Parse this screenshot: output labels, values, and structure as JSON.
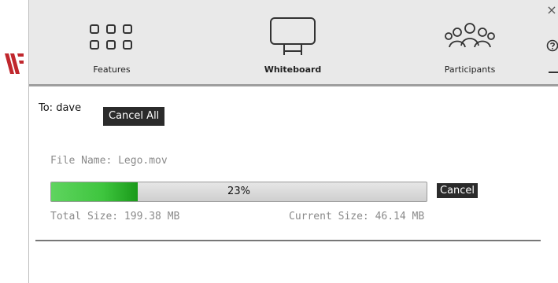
{
  "toolbar": {
    "features_label": "Features",
    "whiteboard_label": "Whiteboard",
    "participants_label": "Participants",
    "close_glyph": "×"
  },
  "transfer": {
    "to_label": "To: dave",
    "cancel_all_label": "Cancel All",
    "file_name": "File Name: Lego.mov",
    "progress_percent": 23,
    "progress_text": "23%",
    "cancel_label": "Cancel",
    "total_size": "Total Size: 199.38 MB",
    "current_size": "Current Size: 46.14 MB"
  },
  "icons": {
    "brand": "brand-logo-icon",
    "features": "grid-icon",
    "whiteboard": "whiteboard-icon",
    "participants": "participants-icon",
    "close": "close-icon",
    "help": "help-icon",
    "menu": "menu-dash-icon"
  },
  "colors": {
    "brand_red": "#c0272d",
    "toolbar_bg": "#e9e9e9",
    "progress_green": "#3ec53e",
    "button_dark": "#2b2b2b",
    "muted_text": "#8a8a8a"
  }
}
